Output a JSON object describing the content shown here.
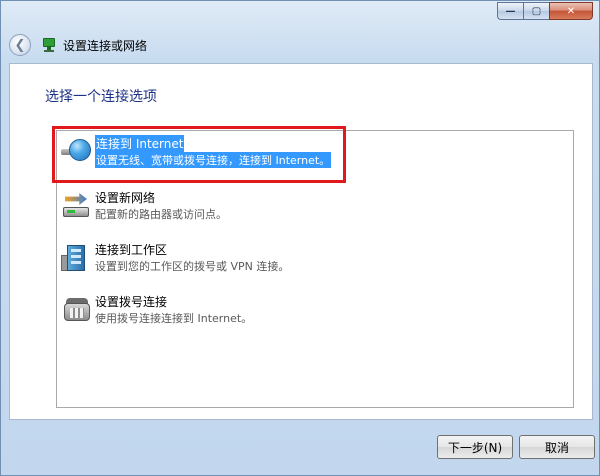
{
  "window": {
    "title": "设置连接或网络",
    "caption": {
      "minimize": "—",
      "maximize": "▢",
      "close": "✕"
    }
  },
  "heading": "选择一个连接选项",
  "options": [
    {
      "title": "连接到 Internet",
      "desc": "设置无线、宽带或拨号连接，连接到 Internet。",
      "icon": "globe-icon",
      "selected": true
    },
    {
      "title": "设置新网络",
      "desc": "配置新的路由器或访问点。",
      "icon": "router-icon",
      "selected": false
    },
    {
      "title": "连接到工作区",
      "desc": "设置到您的工作区的拨号或 VPN 连接。",
      "icon": "workplace-icon",
      "selected": false
    },
    {
      "title": "设置拨号连接",
      "desc": "使用拨号连接连接到 Internet。",
      "icon": "phone-icon",
      "selected": false
    }
  ],
  "buttons": {
    "next": "下一步(N)",
    "cancel": "取消"
  },
  "colors": {
    "selection": "#3399ff",
    "heading": "#1e3287",
    "highlight_border": "#e0191c"
  }
}
